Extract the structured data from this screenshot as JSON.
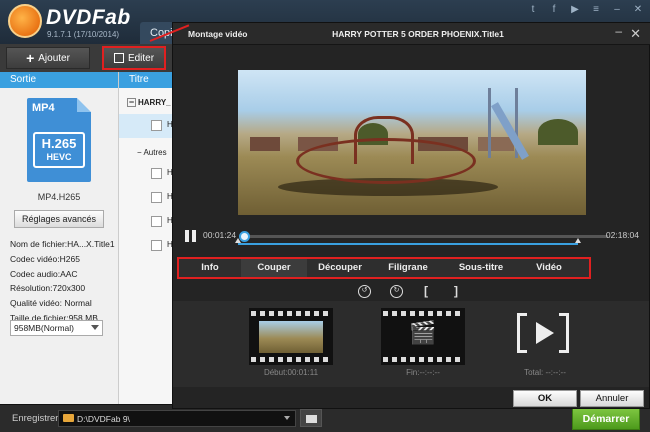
{
  "app": {
    "name": "DVDFab",
    "version": "9.1.7.1 (17/10/2014)",
    "tab_label": "Copie",
    "system_icons": [
      "twitter-icon",
      "facebook-icon",
      "youtube-icon",
      "menu-icon",
      "minimize-icon",
      "close-icon"
    ]
  },
  "toolbar": {
    "add_label": "Ajouter",
    "edit_label": "Editer"
  },
  "left_panel": {
    "header": "Sortie",
    "format_badge": "MP4",
    "codec_line1": "H.265",
    "codec_line2": "HEVC",
    "profile_name": "MP4.H265",
    "advanced_button": "Réglages avancés",
    "info": [
      "Nom de fichier:HA...X.Title1",
      "Codec vidéo:H265",
      "Codec audio:AAC",
      "Résolution:720x300",
      "Qualité vidéo: Normal",
      "Taille de fichier:958 MB"
    ],
    "size_select": "958MB(Normal)"
  },
  "mid_panel": {
    "header": "Titre",
    "group_label": "HARRY_",
    "other_label": "Autres",
    "row_text": "H"
  },
  "dialog": {
    "title_left": "Montage vidéo",
    "title_center": "HARRY POTTER 5 ORDER PHOENIX.Title1",
    "time_current": "00:01:24",
    "time_total": "02:18:04",
    "progress_fraction": 0.0097,
    "tabs": [
      {
        "label": "Info",
        "active": false
      },
      {
        "label": "Couper",
        "active": true
      },
      {
        "label": "Découper",
        "active": false
      },
      {
        "label": "Filigrane",
        "active": false
      },
      {
        "label": "Sous-titre",
        "active": false
      },
      {
        "label": "Vidéo",
        "active": false
      }
    ],
    "tools": {
      "bracket_open": "[",
      "bracket_close": "]"
    },
    "start_label": "Début:00:01:11",
    "end_label": "Fin:--:--:--",
    "total_label": "Total: --:--:--",
    "ok_label": "OK",
    "cancel_label": "Annuler"
  },
  "bottom": {
    "save_label": "Enregistrer:",
    "path": "D:\\DVDFab 9\\",
    "start_button": "Démarrer"
  },
  "colors": {
    "accent_blue": "#3aa0e0",
    "highlight_red": "#e02020",
    "start_green": "#5aae24"
  }
}
